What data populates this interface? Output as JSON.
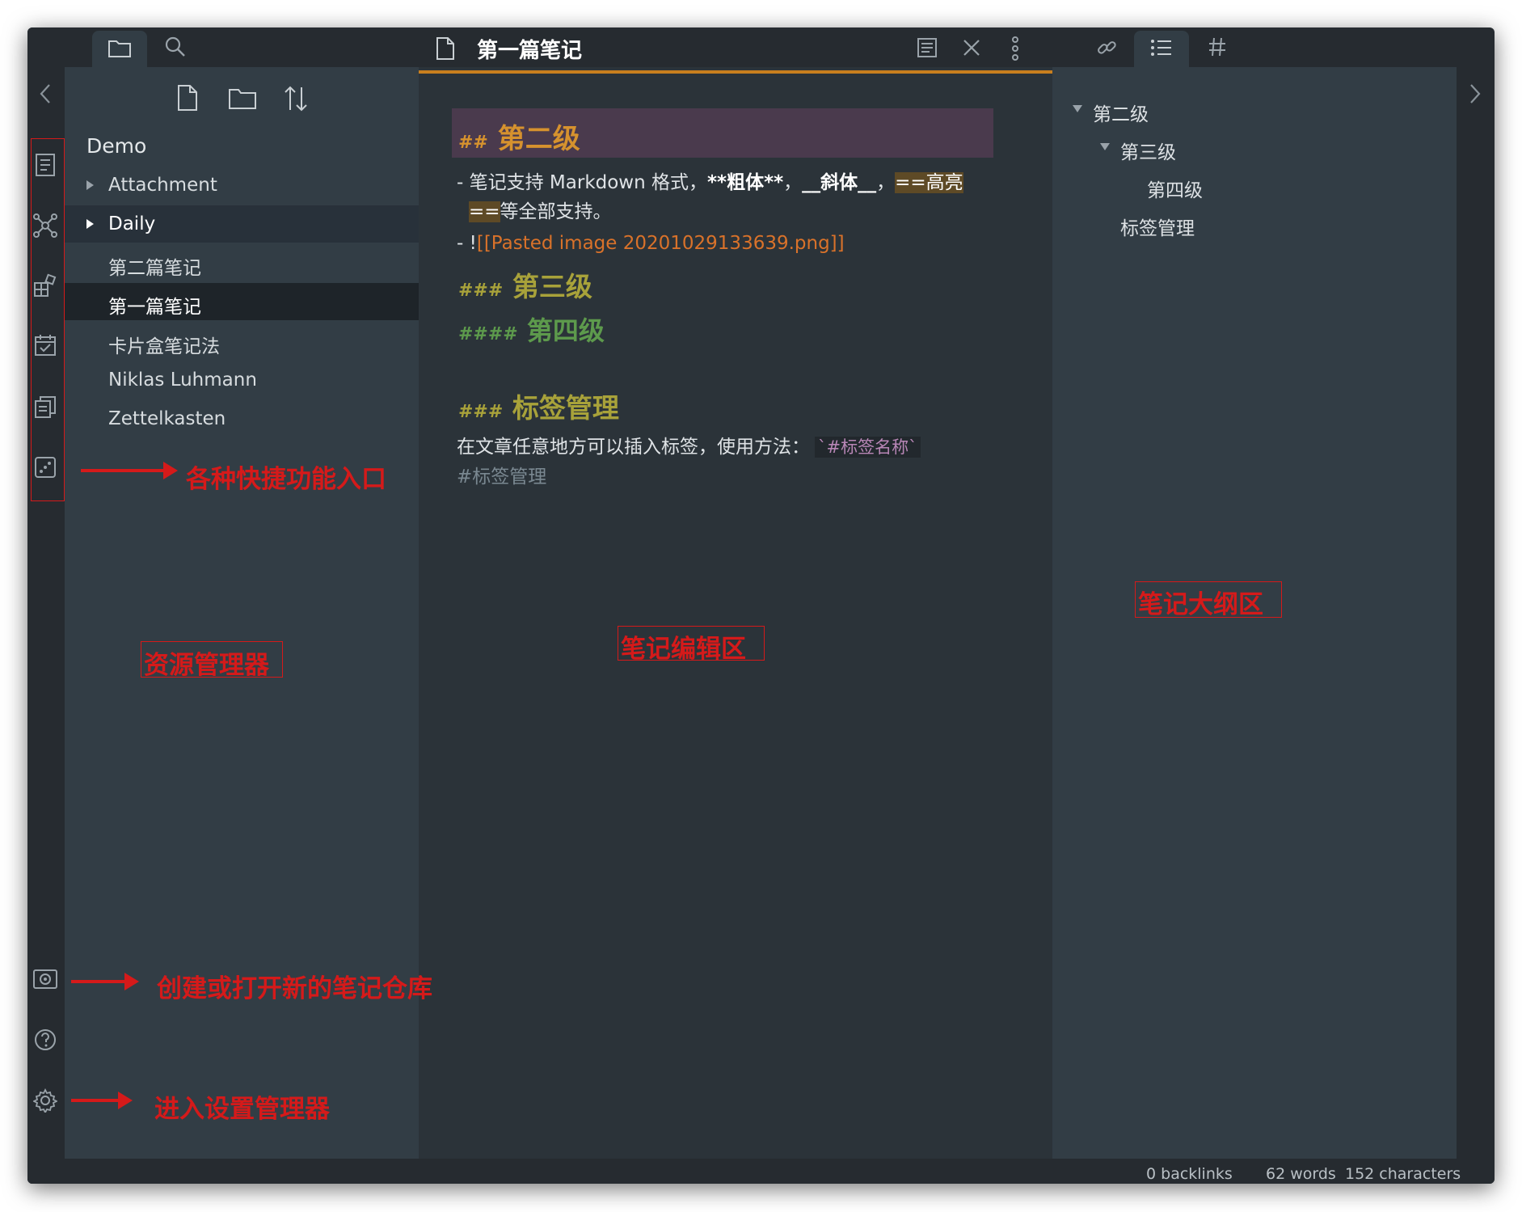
{
  "explorer": {
    "vault_name": "Demo",
    "items": [
      {
        "label": "Attachment",
        "type": "folder"
      },
      {
        "label": "Daily",
        "type": "folder"
      },
      {
        "label": "第二篇笔记",
        "type": "file"
      },
      {
        "label": "第一篇笔记",
        "type": "file"
      },
      {
        "label": "卡片盒笔记法",
        "type": "file"
      },
      {
        "label": "Niklas Luhmann",
        "type": "file"
      },
      {
        "label": "Zettelkasten",
        "type": "file"
      }
    ]
  },
  "editor": {
    "tab_title": "第一篇笔记",
    "h2_mark": "##",
    "h2_text": "第二级",
    "line1_prefix": "- 笔记支持 Markdown 格式，",
    "line1_bold": "**粗体**",
    "line1_sep1": "，",
    "line1_italic": "__斜体__",
    "line1_sep2": "，",
    "line1_highlight_a": "==高亮",
    "line1_highlight_b": "==",
    "line1_suffix": "等全部支持。",
    "line2_prefix": "- !",
    "line2_link": "[[Pasted image 20201029133639.png]]",
    "h3_mark": "###",
    "h3_text": "第三级",
    "h4_mark": "####",
    "h4_text": "第四级",
    "h3b_mark": "###",
    "h3b_text": "标签管理",
    "tag_line_text": "在文章任意地方可以插入标签，使用方法：",
    "tag_line_code": "`#标签名称`",
    "tag": "#标签管理"
  },
  "outline": {
    "items": [
      {
        "label": "第二级",
        "level": 2,
        "collapsible": true
      },
      {
        "label": "第三级",
        "level": 3,
        "collapsible": true
      },
      {
        "label": "第四级",
        "level": 4,
        "collapsible": false
      },
      {
        "label": "标签管理",
        "level": 3,
        "collapsible": false
      }
    ]
  },
  "status": {
    "backlinks": "0 backlinks",
    "words": "62 words",
    "characters": "152 characters"
  },
  "annotations": {
    "shortcuts": "各种快捷功能入口",
    "explorer": "资源管理器",
    "editor": "笔记编辑区",
    "outline": "笔记大纲区",
    "vault": "创建或打开新的笔记仓库",
    "settings": "进入设置管理器"
  },
  "colors": {
    "accent": "#c87f1e",
    "h2": "#d6922e",
    "h3": "#a8a23a",
    "h4": "#5d9a4c",
    "link": "#d9722a",
    "annotation": "#d51a1a"
  }
}
